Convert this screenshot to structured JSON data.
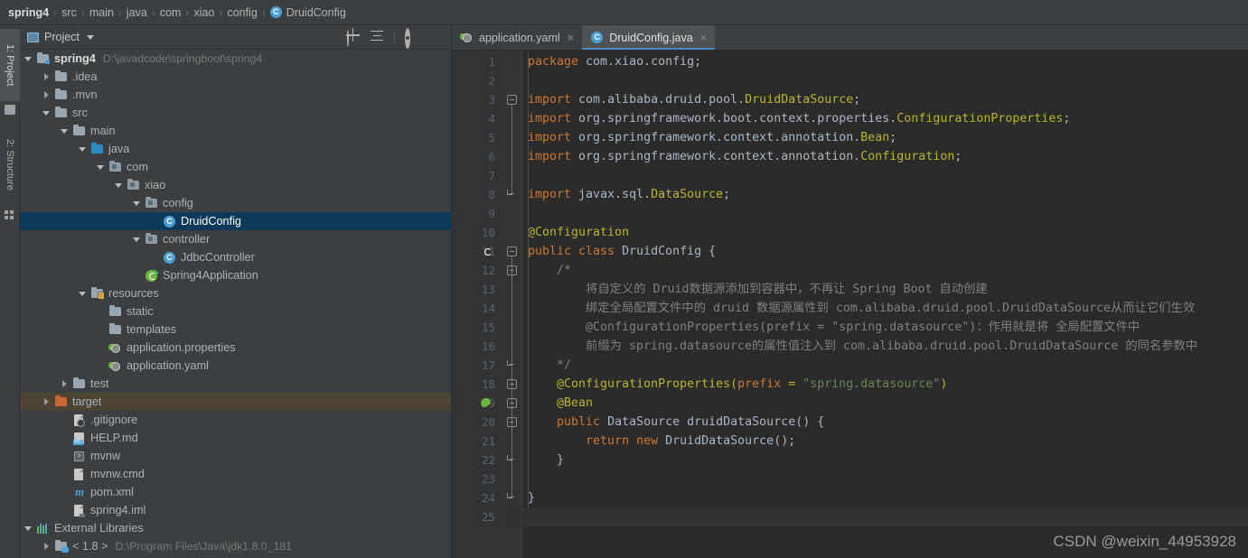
{
  "breadcrumb": {
    "items": [
      "spring4",
      "src",
      "main",
      "java",
      "com",
      "xiao",
      "config"
    ],
    "class_item": "DruidConfig",
    "separator": "›",
    "class_icon": "C"
  },
  "toolstrip": {
    "tabs": [
      {
        "label": "1: Project",
        "icon": "project-folder-icon",
        "active": true
      },
      {
        "label": "2: Structure",
        "icon": "structure-icon",
        "active": false
      }
    ]
  },
  "project_panel": {
    "title": "Project",
    "tools": [
      {
        "name": "locate-in-tree-icon"
      },
      {
        "name": "collapse-all-icon"
      },
      {
        "name": "settings-gear-icon"
      },
      {
        "name": "minimize-icon"
      }
    ],
    "tree": [
      {
        "label": "spring4",
        "sublabel": "D:\\javadcode\\springboot\\spring4",
        "indent": 0,
        "arrow": "down",
        "icon": "folder-module",
        "bold": true
      },
      {
        "label": ".idea",
        "sublabel": "",
        "indent": 1,
        "arrow": "right",
        "icon": "folder-plain"
      },
      {
        "label": ".mvn",
        "sublabel": "",
        "indent": 1,
        "arrow": "right",
        "icon": "folder-plain"
      },
      {
        "label": "src",
        "sublabel": "",
        "indent": 1,
        "arrow": "down",
        "icon": "folder-plain"
      },
      {
        "label": "main",
        "sublabel": "",
        "indent": 2,
        "arrow": "down",
        "icon": "folder-plain"
      },
      {
        "label": "java",
        "sublabel": "",
        "indent": 3,
        "arrow": "down",
        "icon": "folder-source"
      },
      {
        "label": "com",
        "sublabel": "",
        "indent": 4,
        "arrow": "down",
        "icon": "folder-package"
      },
      {
        "label": "xiao",
        "sublabel": "",
        "indent": 5,
        "arrow": "down",
        "icon": "folder-package"
      },
      {
        "label": "config",
        "sublabel": "",
        "indent": 6,
        "arrow": "down",
        "icon": "folder-package"
      },
      {
        "label": "DruidConfig",
        "sublabel": "",
        "indent": 7,
        "arrow": "none",
        "icon": "java-class",
        "selected": true
      },
      {
        "label": "controller",
        "sublabel": "",
        "indent": 6,
        "arrow": "down",
        "icon": "folder-package"
      },
      {
        "label": "JdbcController",
        "sublabel": "",
        "indent": 7,
        "arrow": "none",
        "icon": "java-class"
      },
      {
        "label": "Spring4Application",
        "sublabel": "",
        "indent": 6,
        "arrow": "none",
        "icon": "spring-boot-app"
      },
      {
        "label": "resources",
        "sublabel": "",
        "indent": 3,
        "arrow": "down",
        "icon": "folder-resources"
      },
      {
        "label": "static",
        "sublabel": "",
        "indent": 4,
        "arrow": "none",
        "icon": "folder-plain"
      },
      {
        "label": "templates",
        "sublabel": "",
        "indent": 4,
        "arrow": "none",
        "icon": "folder-plain"
      },
      {
        "label": "application.properties",
        "sublabel": "",
        "indent": 4,
        "arrow": "none",
        "icon": "spring-config"
      },
      {
        "label": "application.yaml",
        "sublabel": "",
        "indent": 4,
        "arrow": "none",
        "icon": "spring-config"
      },
      {
        "label": "test",
        "sublabel": "",
        "indent": 2,
        "arrow": "right",
        "icon": "folder-plain"
      },
      {
        "label": "target",
        "sublabel": "",
        "indent": 1,
        "arrow": "right",
        "icon": "folder-excluded",
        "hover": true
      },
      {
        "label": ".gitignore",
        "sublabel": "",
        "indent": 2,
        "arrow": "none",
        "icon": "gitignore-file"
      },
      {
        "label": "HELP.md",
        "sublabel": "",
        "indent": 2,
        "arrow": "none",
        "icon": "markdown-file"
      },
      {
        "label": "mvnw",
        "sublabel": "",
        "indent": 2,
        "arrow": "none",
        "icon": "shell-file"
      },
      {
        "label": "mvnw.cmd",
        "sublabel": "",
        "indent": 2,
        "arrow": "none",
        "icon": "text-file"
      },
      {
        "label": "pom.xml",
        "sublabel": "",
        "indent": 2,
        "arrow": "none",
        "icon": "maven-file"
      },
      {
        "label": "spring4.iml",
        "sublabel": "",
        "indent": 2,
        "arrow": "none",
        "icon": "iml-file"
      },
      {
        "label": "External Libraries",
        "sublabel": "",
        "indent": 0,
        "arrow": "down",
        "icon": "libraries"
      },
      {
        "label": "< 1.8 >",
        "sublabel": "D:\\Program Files\\Java\\jdk1.8.0_181",
        "indent": 1,
        "arrow": "right",
        "icon": "folder-jdk"
      }
    ]
  },
  "editor": {
    "tabs": [
      {
        "label": "application.yaml",
        "icon": "spring-config",
        "active": false,
        "close": "×"
      },
      {
        "label": "DruidConfig.java",
        "icon": "java-class",
        "active": true,
        "close": "×"
      }
    ],
    "line_count": 25,
    "current_line": 25,
    "gutter_icons": [
      {
        "line": 11,
        "name": "spring-bean-gutter-icon"
      },
      {
        "line": 19,
        "name": "spring-bean-implement-gutter-icon"
      }
    ],
    "lines": [
      {
        "n": 1,
        "tokens": [
          {
            "t": "package ",
            "c": "kw"
          },
          {
            "t": "com.xiao.config;",
            "c": "plain"
          }
        ]
      },
      {
        "n": 2,
        "tokens": []
      },
      {
        "n": 3,
        "tokens": [
          {
            "t": "import ",
            "c": "kw"
          },
          {
            "t": "com.alibaba.druid.pool.",
            "c": "plain"
          },
          {
            "t": "DruidDataSource",
            "c": "cls"
          },
          {
            "t": ";",
            "c": "plain"
          }
        ]
      },
      {
        "n": 4,
        "tokens": [
          {
            "t": "import ",
            "c": "kw"
          },
          {
            "t": "org.springframework.boot.context.properties.",
            "c": "plain"
          },
          {
            "t": "ConfigurationProperties",
            "c": "cls"
          },
          {
            "t": ";",
            "c": "plain"
          }
        ]
      },
      {
        "n": 5,
        "tokens": [
          {
            "t": "import ",
            "c": "kw"
          },
          {
            "t": "org.springframework.context.annotation.",
            "c": "plain"
          },
          {
            "t": "Bean",
            "c": "cls"
          },
          {
            "t": ";",
            "c": "plain"
          }
        ]
      },
      {
        "n": 6,
        "tokens": [
          {
            "t": "import ",
            "c": "kw"
          },
          {
            "t": "org.springframework.context.annotation.",
            "c": "plain"
          },
          {
            "t": "Configuration",
            "c": "cls"
          },
          {
            "t": ";",
            "c": "plain"
          }
        ]
      },
      {
        "n": 7,
        "tokens": []
      },
      {
        "n": 8,
        "tokens": [
          {
            "t": "import ",
            "c": "kw"
          },
          {
            "t": "javax.sql.",
            "c": "plain"
          },
          {
            "t": "DataSource",
            "c": "cls"
          },
          {
            "t": ";",
            "c": "plain"
          }
        ]
      },
      {
        "n": 9,
        "tokens": []
      },
      {
        "n": 10,
        "tokens": [
          {
            "t": "@Configuration",
            "c": "ann"
          }
        ]
      },
      {
        "n": 11,
        "tokens": [
          {
            "t": "public class ",
            "c": "kw"
          },
          {
            "t": "DruidConfig ",
            "c": "plain"
          },
          {
            "t": "{",
            "c": "plain"
          }
        ]
      },
      {
        "n": 12,
        "tokens": [
          {
            "t": "    /*",
            "c": "cmt"
          }
        ]
      },
      {
        "n": 13,
        "tokens": [
          {
            "t": "        将自定义的 Druid数据源添加到容器中，不再让 Spring Boot 自动创建",
            "c": "cmt"
          }
        ]
      },
      {
        "n": 14,
        "tokens": [
          {
            "t": "        绑定全局配置文件中的 druid 数据源属性到 com.alibaba.druid.pool.DruidDataSource从而让它们生效",
            "c": "cmt"
          }
        ]
      },
      {
        "n": 15,
        "tokens": [
          {
            "t": "        @ConfigurationProperties(prefix = \"spring.datasource\")：作用就是将 全局配置文件中",
            "c": "cmt"
          }
        ]
      },
      {
        "n": 16,
        "tokens": [
          {
            "t": "        前缀为 spring.datasource的属性值注入到 com.alibaba.druid.pool.DruidDataSource 的同名参数中",
            "c": "cmt"
          }
        ]
      },
      {
        "n": 17,
        "tokens": [
          {
            "t": "    */",
            "c": "cmt"
          }
        ]
      },
      {
        "n": 18,
        "tokens": [
          {
            "t": "    @ConfigurationProperties(",
            "c": "ann"
          },
          {
            "t": "prefix",
            "c": "kw"
          },
          {
            "t": " = ",
            "c": "ann"
          },
          {
            "t": "\"spring.datasource\"",
            "c": "str"
          },
          {
            "t": ")",
            "c": "ann"
          }
        ]
      },
      {
        "n": 19,
        "tokens": [
          {
            "t": "    @Bean",
            "c": "ann"
          }
        ]
      },
      {
        "n": 20,
        "tokens": [
          {
            "t": "    public ",
            "c": "kw"
          },
          {
            "t": "DataSource ",
            "c": "plain"
          },
          {
            "t": "druidDataSource",
            "c": "plain"
          },
          {
            "t": "() {",
            "c": "plain"
          }
        ]
      },
      {
        "n": 21,
        "tokens": [
          {
            "t": "        return new ",
            "c": "kw"
          },
          {
            "t": "DruidDataSource();",
            "c": "plain"
          }
        ]
      },
      {
        "n": 22,
        "tokens": [
          {
            "t": "    }",
            "c": "plain"
          }
        ]
      },
      {
        "n": 23,
        "tokens": []
      },
      {
        "n": 24,
        "tokens": [
          {
            "t": "}",
            "c": "plain"
          }
        ]
      },
      {
        "n": 25,
        "tokens": []
      }
    ]
  },
  "watermark": "CSDN @weixin_44953928",
  "colors": {
    "panel_bg": "#3c3f41",
    "editor_bg": "#2b2b2b",
    "gutter_bg": "#313335",
    "selection_bg": "#0d3a58",
    "hover_bg": "#4b4334",
    "accent": "#4a9fd4",
    "keyword": "#cc7832",
    "annotation": "#bbb529",
    "string": "#6a8759",
    "comment": "#808080",
    "text": "#a9b7c6"
  }
}
